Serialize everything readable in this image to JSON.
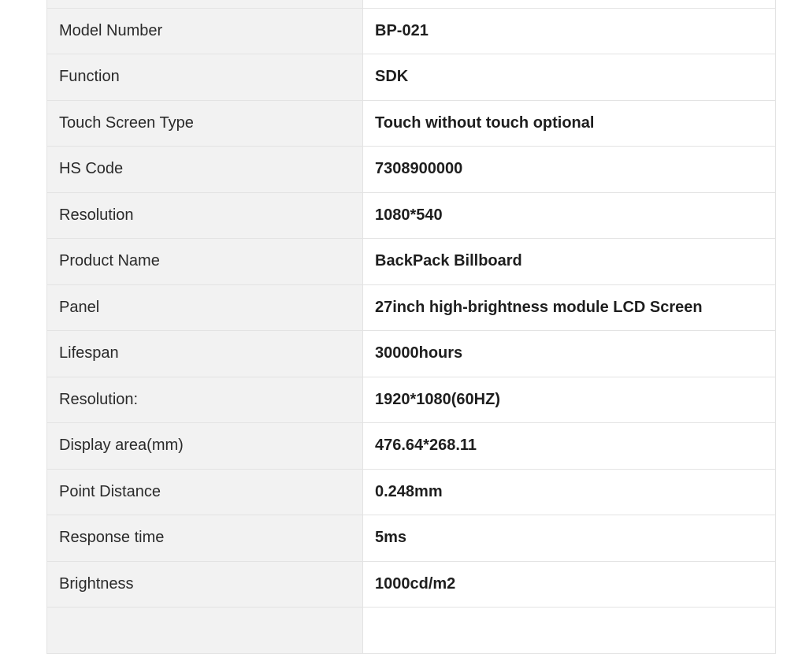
{
  "specs": [
    {
      "key": "",
      "value": ""
    },
    {
      "key": "Model Number",
      "value": "BP-021"
    },
    {
      "key": "Function",
      "value": "SDK"
    },
    {
      "key": "Touch Screen Type",
      "value": "Touch without touch optional"
    },
    {
      "key": "HS Code",
      "value": "7308900000"
    },
    {
      "key": "Resolution",
      "value": "1080*540"
    },
    {
      "key": "Product Name",
      "value": "BackPack Billboard"
    },
    {
      "key": "Panel",
      "value": "27inch high-brightness module LCD Screen"
    },
    {
      "key": "Lifespan",
      "value": "30000hours"
    },
    {
      "key": "Resolution:",
      "value": "1920*1080(60HZ)"
    },
    {
      "key": "Display area(mm)",
      "value": "476.64*268.11"
    },
    {
      "key": "Point Distance",
      "value": "0.248mm"
    },
    {
      "key": "Response time",
      "value": "5ms"
    },
    {
      "key": "Brightness",
      "value": "1000cd/m2"
    },
    {
      "key": "",
      "value": ""
    }
  ]
}
